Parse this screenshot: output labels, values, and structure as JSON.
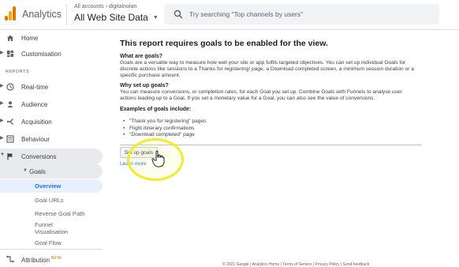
{
  "header": {
    "app_name": "Analytics",
    "account_path": "All accounts › digitalnolan",
    "view_name": "All Web Site Data",
    "search_placeholder": "Try searching \"Top channels by users\""
  },
  "sidebar": {
    "items": [
      {
        "label": "Home",
        "icon": "home-icon"
      },
      {
        "label": "Customisation",
        "icon": "dashboard-icon"
      }
    ],
    "reports_label": "REPORTS",
    "report_items": [
      {
        "label": "Real-time",
        "icon": "clock-icon"
      },
      {
        "label": "Audience",
        "icon": "person-icon"
      },
      {
        "label": "Acquisition",
        "icon": "acquisition-icon"
      },
      {
        "label": "Behaviour",
        "icon": "behaviour-icon"
      },
      {
        "label": "Conversions",
        "icon": "flag-icon"
      }
    ],
    "goals_label": "Goals",
    "goals_sub": [
      "Overview",
      "Goal URLs",
      "Reverse Goal Path",
      "Funnel",
      "Visualisation",
      "Goal Flow"
    ],
    "attribution_label": "Attribution",
    "beta_label": "BETA"
  },
  "main": {
    "title": "This report requires goals to be enabled for the view.",
    "what_heading": "What are goals?",
    "what_text": "Goals are a versatile way to measure how well your site or app fulfils targeted objectives. You can set up individual Goals for discrete actions like sessions to a Thanks for registering! page, a Download completed screen, a minimum session duration or a specific purchase amount.",
    "why_heading": "Why set up goals?",
    "why_text": "You can measure conversions, or completion rates, for each Goal you set up. Combine Goals with Funnels to analyse user actions leading up to a Goal. If you set a monetary value for a Goal, you can also see the value of conversions.",
    "examples_heading": "Examples of goals include:",
    "examples": [
      "\"Thank you for registering\" pages",
      "Flight itinerary confirmations",
      "\"Download completed\" page"
    ],
    "setup_button": "Set up goals",
    "learn_more": "Learn more"
  },
  "footer": {
    "text": "© 2021 Google | Analytics Home | Terms of Service | Privacy Policy | Send feedback"
  },
  "colors": {
    "accent": "#1a73e8",
    "brand": "#f9ab00",
    "highlight": "#f4eb2a"
  }
}
